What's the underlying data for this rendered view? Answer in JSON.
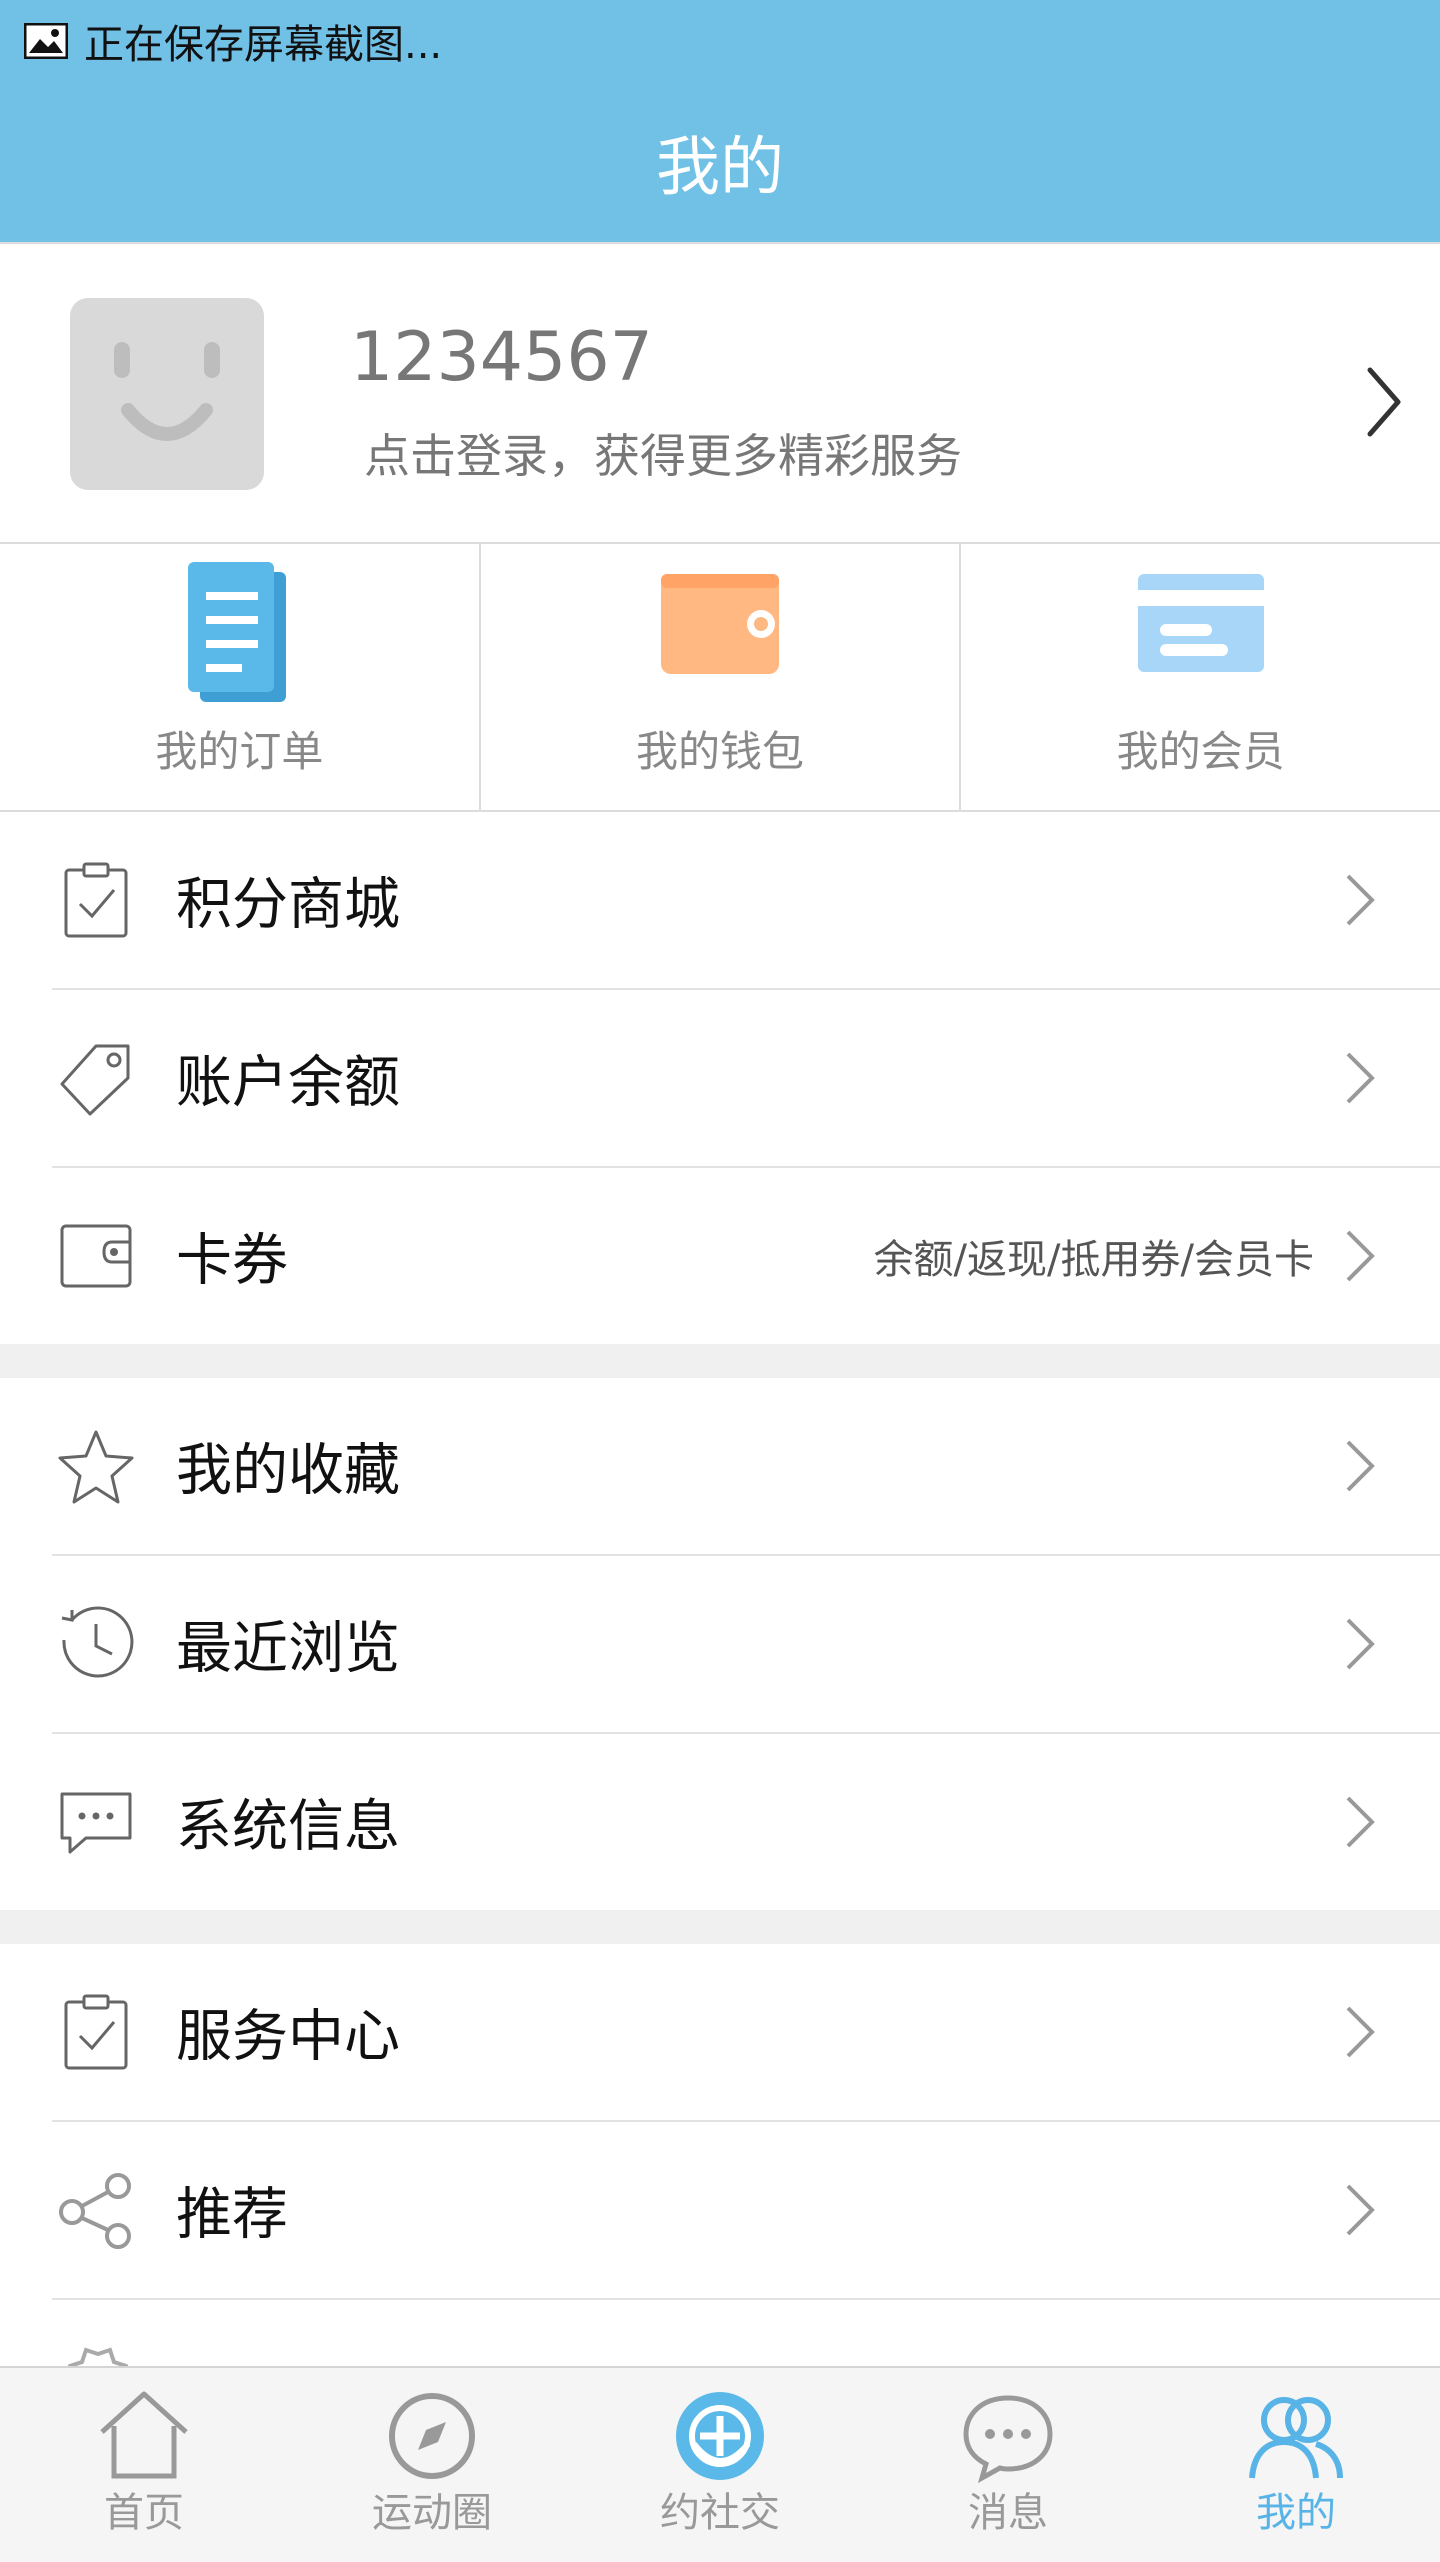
{
  "status_bar": {
    "text": "正在保存屏幕截图..."
  },
  "header": {
    "title": "我的"
  },
  "profile": {
    "user_id": "1234567",
    "subtitle": "点击登录，获得更多精彩服务"
  },
  "quick_actions": [
    {
      "label": "我的订单",
      "icon": "document-icon",
      "color": "#5ab9e8"
    },
    {
      "label": "我的钱包",
      "icon": "wallet-icon",
      "color": "#ffb882"
    },
    {
      "label": "我的会员",
      "icon": "card-icon",
      "color": "#a8d6f8"
    }
  ],
  "sections": [
    {
      "items": [
        {
          "label": "积分商城",
          "icon": "clipboard-check-icon"
        },
        {
          "label": "账户余额",
          "icon": "tag-icon"
        },
        {
          "label": "卡券",
          "icon": "wallet-outline-icon",
          "right_text": "余额/返现/抵用券/会员卡"
        }
      ]
    },
    {
      "items": [
        {
          "label": "我的收藏",
          "icon": "star-icon"
        },
        {
          "label": "最近浏览",
          "icon": "clock-icon"
        },
        {
          "label": "系统信息",
          "icon": "chat-bubble-icon"
        }
      ]
    },
    {
      "items": [
        {
          "label": "服务中心",
          "icon": "clipboard-check-icon"
        },
        {
          "label": "推荐",
          "icon": "share-icon"
        }
      ]
    }
  ],
  "bottom_nav": [
    {
      "label": "首页",
      "icon": "home-icon"
    },
    {
      "label": "运动圈",
      "icon": "compass-icon"
    },
    {
      "label": "约社交",
      "icon": "social-icon"
    },
    {
      "label": "消息",
      "icon": "message-icon"
    },
    {
      "label": "我的",
      "icon": "people-icon",
      "active": true
    }
  ],
  "colors": {
    "header": "#71c0e6",
    "accent": "#58b4e6"
  }
}
